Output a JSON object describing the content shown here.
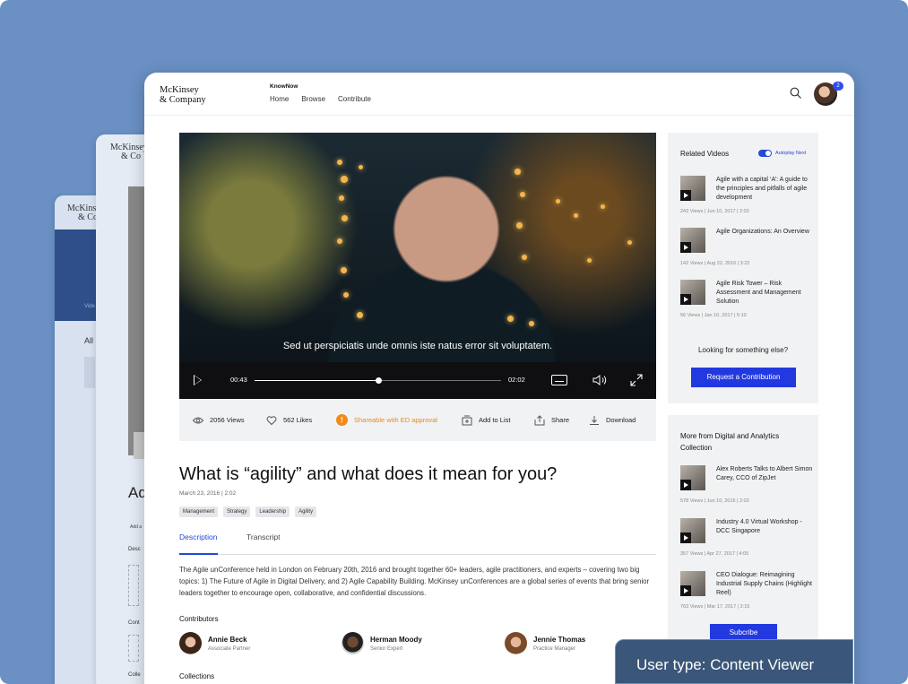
{
  "background": {
    "card_logo_line1": "McKinsey",
    "card_logo_line2": "& Co",
    "card_text_all": "All",
    "card_text_ad": "Ad",
    "card_text_video": "Vide",
    "card_text_desc": "Desc",
    "card_text_cont": "Cont",
    "card_text_coll": "Colle",
    "card_text_add": "Add a"
  },
  "header": {
    "logo_line1": "McKinsey",
    "logo_line2": "& Company",
    "brand": "KnowNow",
    "nav": [
      "Home",
      "Browse",
      "Contribute"
    ],
    "notification_count": "2"
  },
  "video": {
    "subtitle": "Sed ut perspiciatis unde omnis iste natus error sit voluptatem.",
    "current_time": "00:43",
    "total_time": "02:02",
    "progress": 0.5
  },
  "actions": {
    "views": "2056 Views",
    "likes": "562 Likes",
    "shareable": "Shareable with ED approval",
    "add_to_list": "Add to List",
    "share": "Share",
    "download": "Download"
  },
  "article": {
    "title": "What is “agility” and what does it mean for you?",
    "meta": "March 23, 2016  |  2:02",
    "tags": [
      "Management",
      "Strategy",
      "Leadership",
      "Agility"
    ],
    "tabs": [
      "Description",
      "Transcript"
    ],
    "description": "The Agile unConference held in London on February 20th, 2016 and brought together 60+ leaders, agile practitioners, and experts – covering two big topics: 1) The Future of Agile in Digital Delivery, and 2) Agile Capability Building. McKinsey unConferences are a global series of events that bring senior leaders together to encourage open, collaborative, and confidential discussions.",
    "contributors_heading": "Contributors",
    "contributors": [
      {
        "name": "Annie Beck",
        "role": "Associate Partner"
      },
      {
        "name": "Herman Moody",
        "role": "Senior Expert"
      },
      {
        "name": "Jennie Thomas",
        "role": "Practice Manager"
      }
    ],
    "collections_heading": "Collections"
  },
  "related": {
    "heading": "Related Videos",
    "autoplay_label": "Autoplay Next",
    "items": [
      {
        "title": "Agile with a capital ‘A’: A guide to the principles and pitfalls of agile development",
        "meta": "243 Views  |  Jun 10, 2017  |  2:02"
      },
      {
        "title": "Agile Organizations: An Overview",
        "meta": "142 Views  |  Aug 22, 2016  |  3:22"
      },
      {
        "title": "Agile Risk Tower – Risk Assessment and Management Solution",
        "meta": "56 Views  |  Jan 10, 2017  |  5:10"
      }
    ],
    "looking_text": "Looking for something else?",
    "request_button": "Request a Contribution"
  },
  "collection": {
    "heading": "More from Digital and Analytics Collection",
    "items": [
      {
        "title": "Alex Roberts Talks to Albert Simon Carey, CCO of ZipJet",
        "meta": "578 Views  |  Jun 10, 2016  |  2:02"
      },
      {
        "title": "Industry 4.0 Virtual Workshop - DCC Singapore",
        "meta": "357 Views  |  Apr 27, 2017  |  4:05"
      },
      {
        "title": "CEO Dialogue: Reimagining Industrial Supply Chains (Highlight Reel)",
        "meta": "763 Views  |  Mar 17, 2017  |  2:15"
      }
    ],
    "subscribe_button": "Subcribe"
  },
  "overlay": {
    "user_type": "User type: Content Viewer"
  },
  "colors": {
    "accent": "#2239e0",
    "background": "#6a90c4",
    "shareable": "#f08a1c"
  }
}
